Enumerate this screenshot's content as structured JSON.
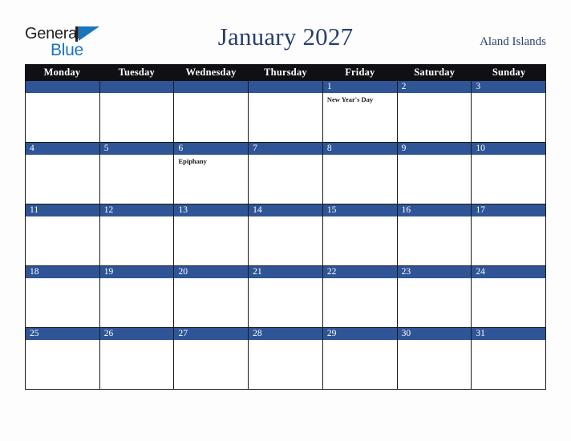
{
  "brand": {
    "name_part1": "General",
    "name_part2": "Blue",
    "triangle_icon": "triangle-right-icon",
    "color_dark": "#231f20",
    "color_blue": "#1b75bc"
  },
  "header": {
    "month_title": "January 2027",
    "country": "Aland Islands",
    "title_color": "#2a3f6b"
  },
  "colors": {
    "header_bar": "#0f0f14",
    "day_bar": "#2f5597",
    "grid_line": "#1a1a1a",
    "page_background": "#fdfdfe",
    "cell_background": "#ffffff"
  },
  "calendar": {
    "weekdays": [
      "Monday",
      "Tuesday",
      "Wednesday",
      "Thursday",
      "Friday",
      "Saturday",
      "Sunday"
    ],
    "weeks": [
      [
        {
          "day": "",
          "events": []
        },
        {
          "day": "",
          "events": []
        },
        {
          "day": "",
          "events": []
        },
        {
          "day": "",
          "events": []
        },
        {
          "day": "1",
          "events": [
            "New Year's Day"
          ]
        },
        {
          "day": "2",
          "events": []
        },
        {
          "day": "3",
          "events": []
        }
      ],
      [
        {
          "day": "4",
          "events": []
        },
        {
          "day": "5",
          "events": []
        },
        {
          "day": "6",
          "events": [
            "Epiphany"
          ]
        },
        {
          "day": "7",
          "events": []
        },
        {
          "day": "8",
          "events": []
        },
        {
          "day": "9",
          "events": []
        },
        {
          "day": "10",
          "events": []
        }
      ],
      [
        {
          "day": "11",
          "events": []
        },
        {
          "day": "12",
          "events": []
        },
        {
          "day": "13",
          "events": []
        },
        {
          "day": "14",
          "events": []
        },
        {
          "day": "15",
          "events": []
        },
        {
          "day": "16",
          "events": []
        },
        {
          "day": "17",
          "events": []
        }
      ],
      [
        {
          "day": "18",
          "events": []
        },
        {
          "day": "19",
          "events": []
        },
        {
          "day": "20",
          "events": []
        },
        {
          "day": "21",
          "events": []
        },
        {
          "day": "22",
          "events": []
        },
        {
          "day": "23",
          "events": []
        },
        {
          "day": "24",
          "events": []
        }
      ],
      [
        {
          "day": "25",
          "events": []
        },
        {
          "day": "26",
          "events": []
        },
        {
          "day": "27",
          "events": []
        },
        {
          "day": "28",
          "events": []
        },
        {
          "day": "29",
          "events": []
        },
        {
          "day": "30",
          "events": []
        },
        {
          "day": "31",
          "events": []
        }
      ]
    ]
  }
}
